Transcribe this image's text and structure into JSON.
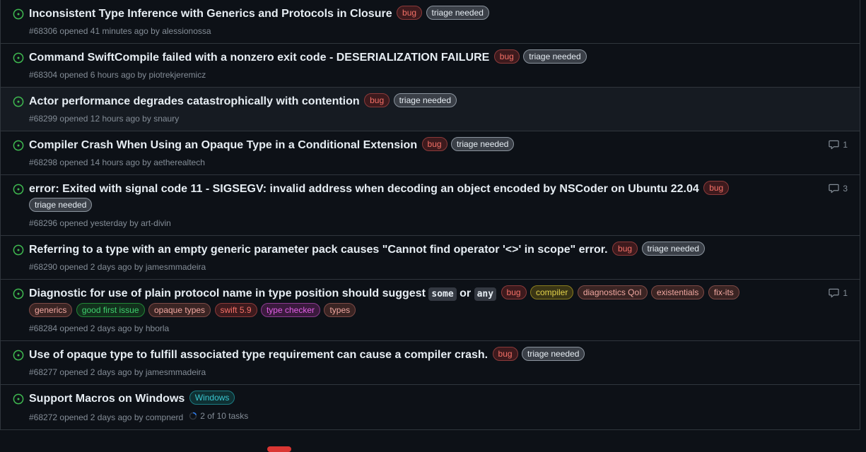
{
  "issues": [
    {
      "title": "Inconsistent Type Inference with Generics and Protocols in Closure",
      "labels": [
        "bug",
        "triage needed"
      ],
      "number": "#68306",
      "opened": "opened 41 minutes ago by",
      "author": "alessionossa"
    },
    {
      "title": "Command SwiftCompile failed with a nonzero exit code - DESERIALIZATION FAILURE",
      "labels": [
        "bug",
        "triage needed"
      ],
      "number": "#68304",
      "opened": "opened 6 hours ago by",
      "author": "piotrekjeremicz"
    },
    {
      "title": "Actor performance degrades catastrophically with contention",
      "labels": [
        "bug",
        "triage needed"
      ],
      "number": "#68299",
      "opened": "opened 12 hours ago by",
      "author": "snaury"
    },
    {
      "title": "Compiler Crash When Using an Opaque Type in a Conditional Extension",
      "labels": [
        "bug",
        "triage needed"
      ],
      "number": "#68298",
      "opened": "opened 14 hours ago by",
      "author": "aetherealtech",
      "comments": "1"
    },
    {
      "title": "error: Exited with signal code 11 - SIGSEGV: invalid address when decoding an object encoded by NSCoder on Ubuntu 22.04",
      "labels": [
        "bug",
        "triage needed"
      ],
      "number": "#68296",
      "opened": "opened yesterday by",
      "author": "art-divin",
      "comments": "3"
    },
    {
      "title": "Referring to a type with an empty generic parameter pack causes \"Cannot find operator '<>' in scope\" error.",
      "labels": [
        "bug",
        "triage needed"
      ],
      "number": "#68290",
      "opened": "opened 2 days ago by",
      "author": "jamesmmadeira"
    },
    {
      "title_parts": [
        "Diagnostic for use of plain protocol name in type position should suggest ",
        "some",
        " or ",
        "any"
      ],
      "labels": [
        "bug",
        "compiler",
        "diagnostics QoI",
        "existentials",
        "fix-its",
        "generics",
        "good first issue",
        "opaque types",
        "swift 5.9",
        "type checker",
        "types"
      ],
      "number": "#68284",
      "opened": "opened 2 days ago by",
      "author": "hborla",
      "comments": "1"
    },
    {
      "title": "Use of opaque type to fulfill associated type requirement can cause a compiler crash.",
      "labels": [
        "bug",
        "triage needed"
      ],
      "number": "#68277",
      "opened": "opened 2 days ago by",
      "author": "jamesmmadeira"
    },
    {
      "title": "Support Macros on Windows",
      "labels": [
        "Windows"
      ],
      "number": "#68272",
      "opened": "opened 2 days ago by",
      "author": "compnerd",
      "tasks": "2 of 10 tasks"
    }
  ],
  "label_colors": {
    "bug": {
      "fg": "#f47067",
      "bg": "#3d1a1d",
      "border": "#8b3a3a"
    },
    "triage needed": {
      "fg": "#e6edf3",
      "bg": "#3a3f47",
      "border": "#8b949e"
    },
    "compiler": {
      "fg": "#e3d24a",
      "bg": "#3a3515",
      "border": "#8a7d1e"
    },
    "diagnostics QoI": {
      "fg": "#f0a7a0",
      "bg": "#3a2423",
      "border": "#7d4a46"
    },
    "existentials": {
      "fg": "#f0a7a0",
      "bg": "#3a2423",
      "border": "#7d4a46"
    },
    "fix-its": {
      "fg": "#f0a7a0",
      "bg": "#3a2423",
      "border": "#7d4a46"
    },
    "generics": {
      "fg": "#f0a7a0",
      "bg": "#3a2423",
      "border": "#7d4a46"
    },
    "good first issue": {
      "fg": "#3fd06e",
      "bg": "#12301c",
      "border": "#238636"
    },
    "opaque types": {
      "fg": "#f0a7a0",
      "bg": "#3a2423",
      "border": "#7d4a46"
    },
    "swift 5.9": {
      "fg": "#f47067",
      "bg": "#3d1a1d",
      "border": "#8b3a3a"
    },
    "type checker": {
      "fg": "#e25fe7",
      "bg": "#3a1a3d",
      "border": "#8b3a8f"
    },
    "types": {
      "fg": "#f0a7a0",
      "bg": "#3a2423",
      "border": "#7d4a46"
    },
    "Windows": {
      "fg": "#39c5cf",
      "bg": "#0f3033",
      "border": "#1b7c83"
    }
  },
  "open_icon_color": "#3fb950"
}
